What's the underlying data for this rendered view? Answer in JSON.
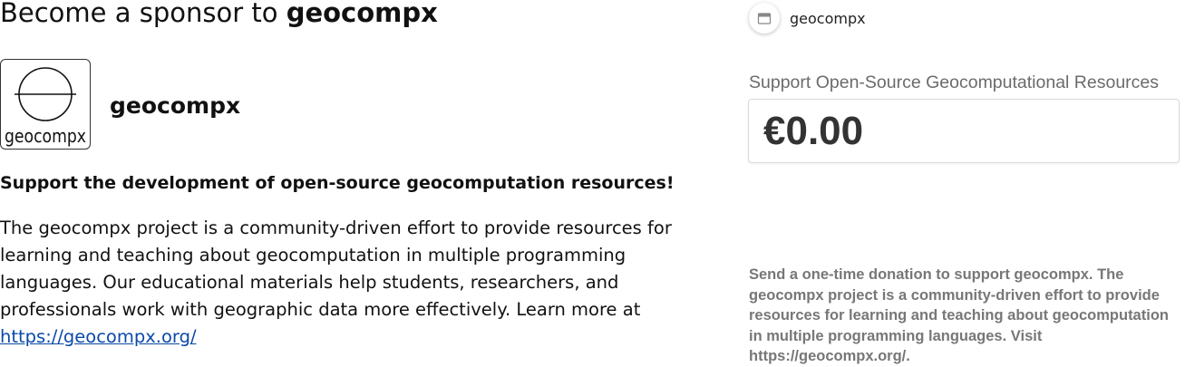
{
  "header": {
    "title_prefix": "Become a sponsor to",
    "title_org": "geocompx"
  },
  "profile": {
    "logo_text": "geocompx",
    "name": "geocompx"
  },
  "content": {
    "tagline": "Support the development of open-source geocomputation resources!",
    "description": "The geocompx project is a community-driven effort to provide resources for learning and teaching about geocomputation in multiple programming languages. Our educational materials help students, researchers, and professionals work with geographic data more effectively. Learn more at",
    "link_text": "https://geocompx.org/"
  },
  "checkout": {
    "creator_name": "geocompx",
    "creator_icon": "store-icon",
    "product_title": "Support Open-Source Geocomputational Resources",
    "amount": "€0.00",
    "note": "Send a one-time donation to support geocompx. The geocompx project is a community-driven effort to provide resources for learning and teaching about geocomputation in multiple programming languages. Visit https://geocompx.org/."
  }
}
